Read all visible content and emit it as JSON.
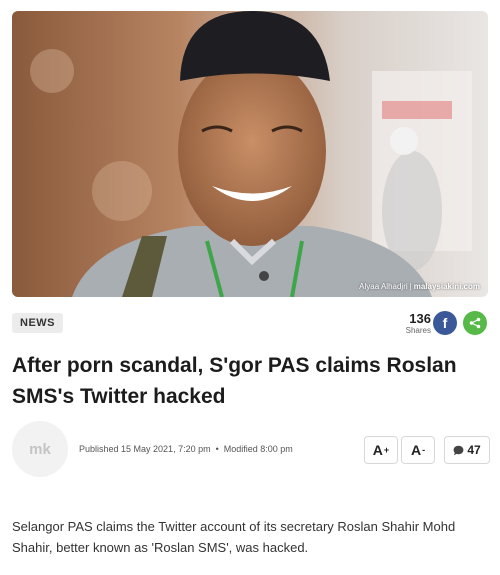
{
  "hero": {
    "credit_photographer": "Alyaa Alhadjri",
    "credit_brand": "malaysiakini.com"
  },
  "category": "NEWS",
  "shares": {
    "count": "136",
    "label": "Shares"
  },
  "headline": "After porn scandal, S'gor PAS claims Roslan SMS's Twitter hacked",
  "logo_text": "mk",
  "meta": {
    "published": "Published 15 May 2021, 7:20 pm",
    "modified": "Modified 8:00 pm"
  },
  "controls": {
    "increase_label": "A",
    "increase_sup": "+",
    "decrease_label": "A",
    "decrease_sup": "-",
    "comment_count": "47"
  },
  "body": "Selangor PAS claims the Twitter account of its secretary Roslan Shahir Mohd Shahir, better known as 'Roslan SMS', was hacked.",
  "colors": {
    "facebook": "#3b5998",
    "share": "#56b948"
  },
  "icons": [
    "facebook-icon",
    "share-icon",
    "comment-icon"
  ]
}
